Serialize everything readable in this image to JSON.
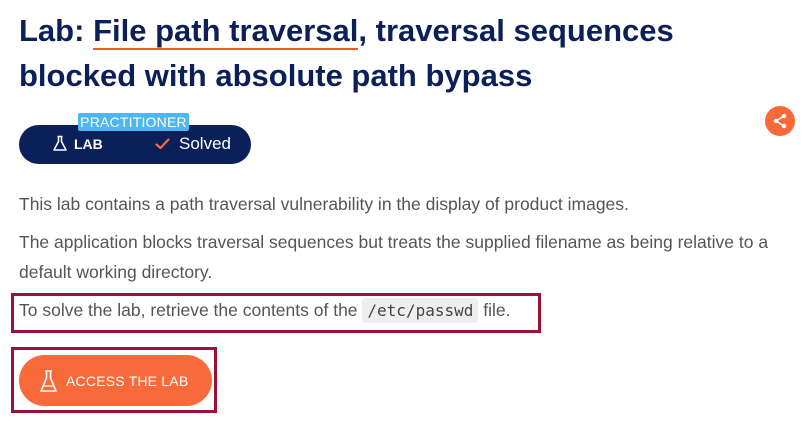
{
  "lab": {
    "title_prefix": "Lab: ",
    "title_link": "File path traversal",
    "title_suffix": ", traversal sequences blocked with absolute path bypass",
    "level": "PRACTITIONER",
    "lab_label": "LAB",
    "status": "Solved"
  },
  "description": {
    "p1": "This lab contains a path traversal vulnerability in the display of product images.",
    "p2": "The application blocks traversal sequences but treats the supplied filename as being relative to a default working directory.",
    "p3_before": "To solve the lab, retrieve the contents of the ",
    "p3_code": "/etc/passwd",
    "p3_after": " file."
  },
  "actions": {
    "access_label": "ACCESS THE LAB"
  },
  "colors": {
    "navy": "#0b1f59",
    "accent": "#f96a3a",
    "level_blue": "#4cb7f0",
    "highlight": "#9c1136"
  },
  "icons": {
    "share": "share-icon",
    "flask": "flask-icon",
    "check": "check-icon"
  }
}
